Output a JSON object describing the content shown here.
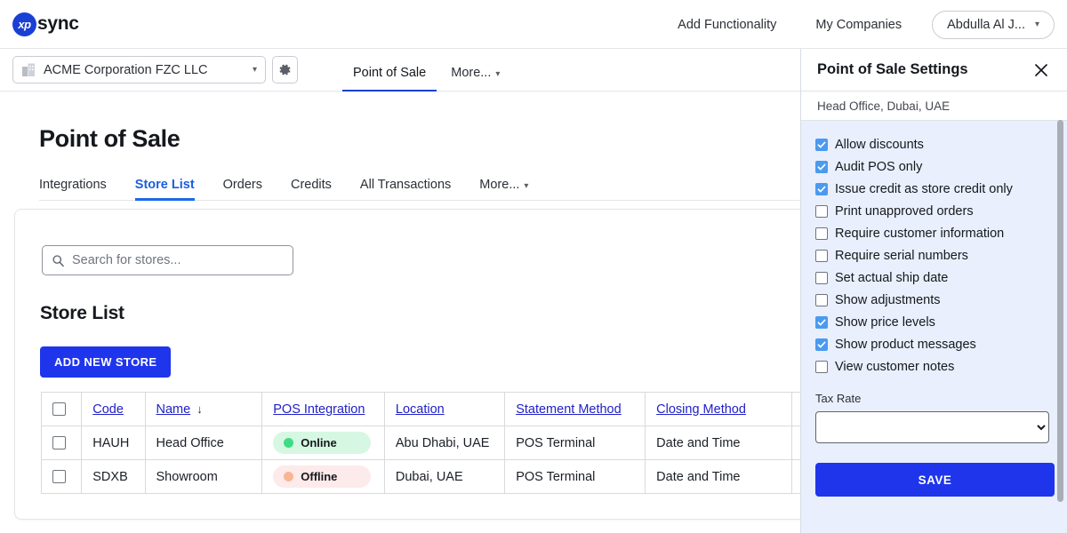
{
  "brand": {
    "badge": "xp",
    "name": "sync"
  },
  "topnav": {
    "links": [
      {
        "label": "Add Functionality"
      },
      {
        "label": "My Companies"
      }
    ],
    "user": {
      "label": "Abdulla Al J...",
      "caret": "chevron-down-icon"
    }
  },
  "secondbar": {
    "company": {
      "value": "ACME Corporation FZC LLC",
      "icon": "building-icon",
      "caret": "chevron-down-icon"
    },
    "settings_icon": "gear-icon",
    "tabs": [
      {
        "label": "Point of Sale",
        "active": true
      },
      {
        "label": "More...",
        "active": false,
        "caret": "chevron-down-icon"
      }
    ]
  },
  "main": {
    "title": "Point of Sale",
    "tabs": [
      {
        "label": "Integrations",
        "active": false
      },
      {
        "label": "Store List",
        "active": true
      },
      {
        "label": "Orders",
        "active": false
      },
      {
        "label": "Credits",
        "active": false
      },
      {
        "label": "All Transactions",
        "active": false
      },
      {
        "label": "More...",
        "active": false,
        "caret": "chevron-down-icon"
      }
    ],
    "search": {
      "placeholder": "Search for stores...",
      "value": "",
      "icon": "search-icon"
    },
    "list_title": "Store List",
    "add_button": "ADD NEW STORE",
    "table": {
      "select_all": "",
      "columns": [
        {
          "label": "Code",
          "sorted": false
        },
        {
          "label": "Name",
          "sorted": true,
          "sort_dir": "↓"
        },
        {
          "label": "POS Integration",
          "sorted": false
        },
        {
          "label": "Location",
          "sorted": false
        },
        {
          "label": "Statement Method",
          "sorted": false
        },
        {
          "label": "Closing Method",
          "sorted": false
        }
      ],
      "rows": [
        {
          "code": "HAUH",
          "name": "Head Office",
          "pos_integration": "Online",
          "pos_status": "online",
          "location": "Abu Dhabi, UAE",
          "statement_method": "POS Terminal",
          "closing_method": "Date and Time"
        },
        {
          "code": "SDXB",
          "name": "Showroom",
          "pos_integration": "Offline",
          "pos_status": "offline",
          "location": "Dubai, UAE",
          "statement_method": "POS Terminal",
          "closing_method": "Date and Time"
        }
      ]
    }
  },
  "panel": {
    "title": "Point of Sale Settings",
    "close_icon": "close-icon",
    "subtitle": "Head Office, Dubai, UAE",
    "options": [
      {
        "label": "Allow discounts",
        "checked": true
      },
      {
        "label": "Audit POS only",
        "checked": true
      },
      {
        "label": "Issue credit as store credit only",
        "checked": true
      },
      {
        "label": "Print unapproved orders",
        "checked": false
      },
      {
        "label": "Require customer information",
        "checked": false
      },
      {
        "label": "Require serial numbers",
        "checked": false
      },
      {
        "label": "Set actual ship date",
        "checked": false
      },
      {
        "label": "Show adjustments",
        "checked": false
      },
      {
        "label": "Show price levels",
        "checked": true
      },
      {
        "label": "Show product messages",
        "checked": true
      },
      {
        "label": "View customer notes",
        "checked": false
      }
    ],
    "tax_rate": {
      "label": "Tax Rate",
      "value": "",
      "options": [
        ""
      ]
    },
    "save_button": "SAVE"
  },
  "colors": {
    "brand_blue": "#1a3fd4",
    "action_blue": "#1f35ec",
    "link_blue": "#2020c8",
    "tab_blue": "#1a6ae8",
    "checkbox_blue": "#4a9af0",
    "online_bg": "#d6f7e2",
    "online_dot": "#3ddc84",
    "offline_bg": "#fdeaea",
    "offline_dot": "#f7b694",
    "panel_bg": "#e9effc"
  }
}
